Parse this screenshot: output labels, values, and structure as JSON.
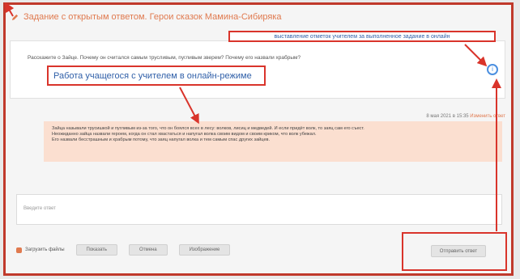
{
  "header": {
    "title": "Задание с открытым ответом. Герои сказок Мамина-Сибиряка"
  },
  "annotations": {
    "top": "выставление отметок учителем за выполненное задание в онлайн",
    "main": "Работа учащегося с учителем в онлайн-режиме"
  },
  "question": {
    "text": "Расскажите о Зайце. Почему он считался самым трусливым, пугливым зверем? Почему его назвали храбрым?"
  },
  "info_icon": {
    "glyph": "i"
  },
  "message": {
    "date": "8 мая 2021 в 15:35",
    "link": "Изменить ответ",
    "lines": [
      "Зайца называли трусишкой и пугливым из-за того, что он боялся всех в лесу: волков, лисиц и медведей. И если придёт волк, то заяц сам его съест.",
      "Неожиданно зайца назвали героем, когда он стал хвастаться и напугал волка своим видом и своим криком, что волк убежал.",
      "Его назвали бесстрашным и храбрым потому, что заяц напугал волка и тем самым спас других зайцев."
    ]
  },
  "answer": {
    "placeholder": "Введите ответ"
  },
  "toolbar": {
    "attach_label": "Загрузить файлы",
    "btn1": "Показать",
    "btn2": "Отмена",
    "btn3": "Изображение",
    "send": "Отправить ответ"
  },
  "colors": {
    "accent": "#d9342b",
    "link": "#2f5fa8",
    "bubble": "#fbdfd0"
  }
}
